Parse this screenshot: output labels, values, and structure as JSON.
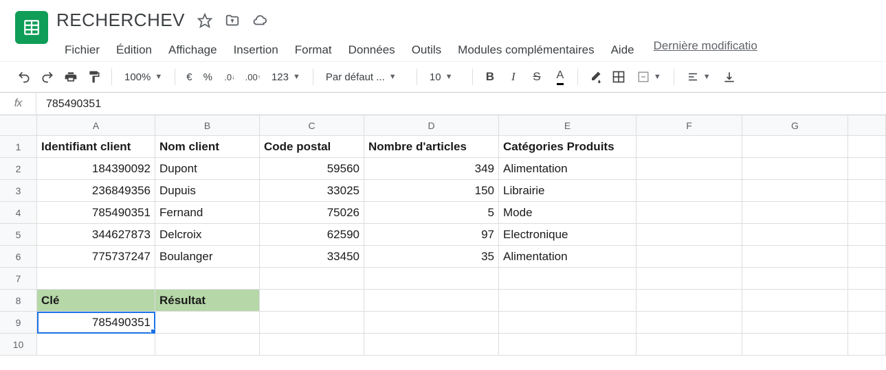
{
  "doc": {
    "title": "RECHERCHEV"
  },
  "menu": {
    "file": "Fichier",
    "edit": "Édition",
    "view": "Affichage",
    "insert": "Insertion",
    "format": "Format",
    "data": "Données",
    "tools": "Outils",
    "addons": "Modules complémentaires",
    "help": "Aide",
    "lastmod": "Dernière modificatio"
  },
  "toolbar": {
    "zoom": "100%",
    "currency": "€",
    "percent": "%",
    "numfmt": "123",
    "font": "Par défaut ...",
    "size": "10"
  },
  "formula": {
    "fx": "fx",
    "value": "785490351"
  },
  "cols": [
    "A",
    "B",
    "C",
    "D",
    "E",
    "F",
    "G"
  ],
  "rows": [
    "1",
    "2",
    "3",
    "4",
    "5",
    "6",
    "7",
    "8",
    "9",
    "10"
  ],
  "sheet": {
    "h": {
      "a": "Identifiant client",
      "b": "Nom client",
      "c": "Code postal",
      "d": "Nombre d'articles",
      "e": "Catégories Produits"
    },
    "r2": {
      "a": "184390092",
      "b": "Dupont",
      "c": "59560",
      "d": "349",
      "e": "Alimentation"
    },
    "r3": {
      "a": "236849356",
      "b": "Dupuis",
      "c": "33025",
      "d": "150",
      "e": "Librairie"
    },
    "r4": {
      "a": "785490351",
      "b": "Fernand",
      "c": "75026",
      "d": "5",
      "e": "Mode"
    },
    "r5": {
      "a": "344627873",
      "b": "Delcroix",
      "c": "62590",
      "d": "97",
      "e": "Electronique"
    },
    "r6": {
      "a": "775737247",
      "b": "Boulanger",
      "c": "33450",
      "d": "35",
      "e": "Alimentation"
    },
    "r8": {
      "a": "Clé",
      "b": "Résultat"
    },
    "r9": {
      "a": "785490351"
    }
  }
}
